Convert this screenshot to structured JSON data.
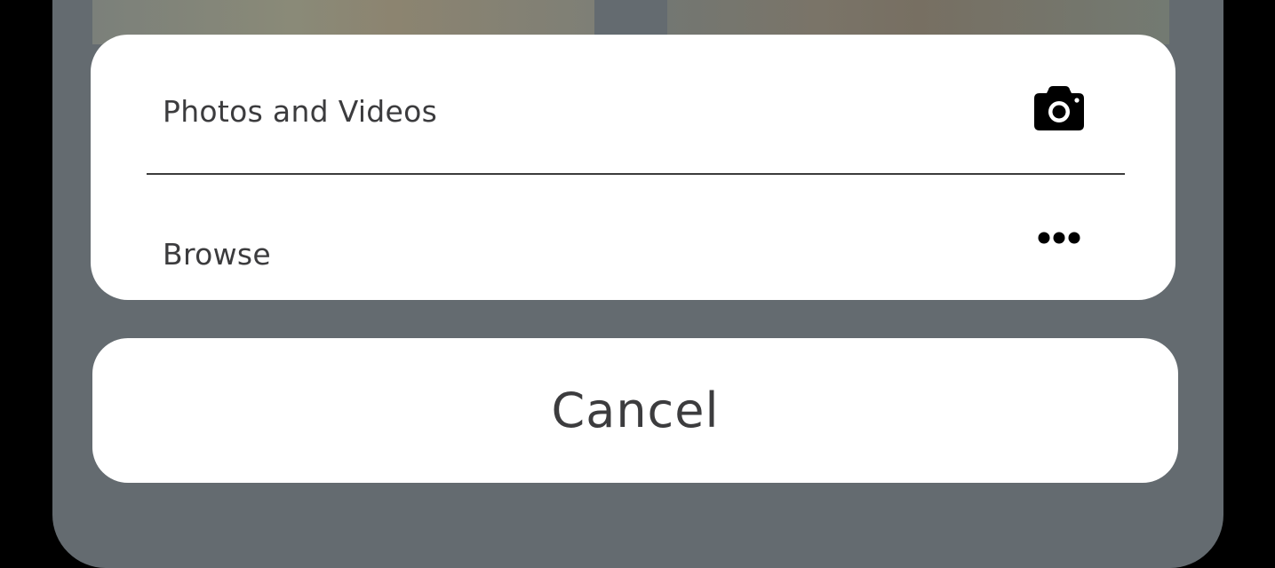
{
  "action_sheet": {
    "items": [
      {
        "label": "Photos and Videos",
        "icon": "camera-icon"
      },
      {
        "label": "Browse",
        "icon": "more-dots-icon"
      }
    ]
  },
  "cancel": {
    "label": "Cancel"
  },
  "colors": {
    "backdrop": "#646b70",
    "card": "#ffffff",
    "text": "#3c3c3e",
    "icon": "#000000",
    "outer": "#000000"
  }
}
